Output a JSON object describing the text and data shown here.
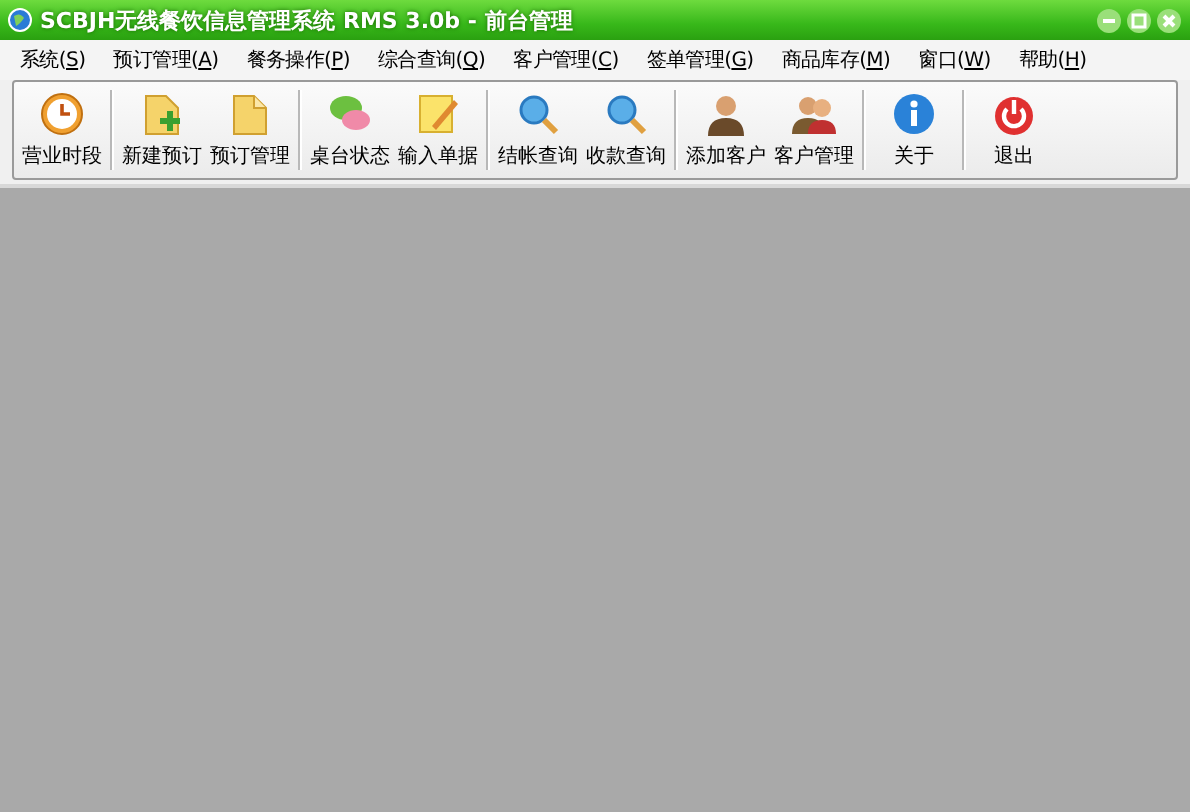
{
  "window": {
    "title": "SCBJH无线餐饮信息管理系统 RMS  3.0b  - 前台管理"
  },
  "menu": [
    {
      "label": "系统(S)"
    },
    {
      "label": "预订管理(A)"
    },
    {
      "label": "餐务操作(P)"
    },
    {
      "label": "综合查询(Q)"
    },
    {
      "label": "客户管理(C)"
    },
    {
      "label": "签单管理(G)"
    },
    {
      "label": "商品库存(M)"
    },
    {
      "label": "窗口(W)"
    },
    {
      "label": "帮助(H)"
    }
  ],
  "toolbar": [
    [
      {
        "label": "营业时段",
        "kind": "clock"
      }
    ],
    [
      {
        "label": "新建预订",
        "kind": "folder-plus"
      },
      {
        "label": "预订管理",
        "kind": "folder"
      }
    ],
    [
      {
        "label": "桌台状态",
        "kind": "chat"
      },
      {
        "label": "输入单据",
        "kind": "note"
      }
    ],
    [
      {
        "label": "结帐查询",
        "kind": "search"
      },
      {
        "label": "收款查询",
        "kind": "search"
      }
    ],
    [
      {
        "label": "添加客户",
        "kind": "person"
      },
      {
        "label": "客户管理",
        "kind": "people"
      }
    ],
    [
      {
        "label": "关于",
        "kind": "info"
      }
    ],
    [
      {
        "label": "退出",
        "kind": "power"
      }
    ]
  ]
}
